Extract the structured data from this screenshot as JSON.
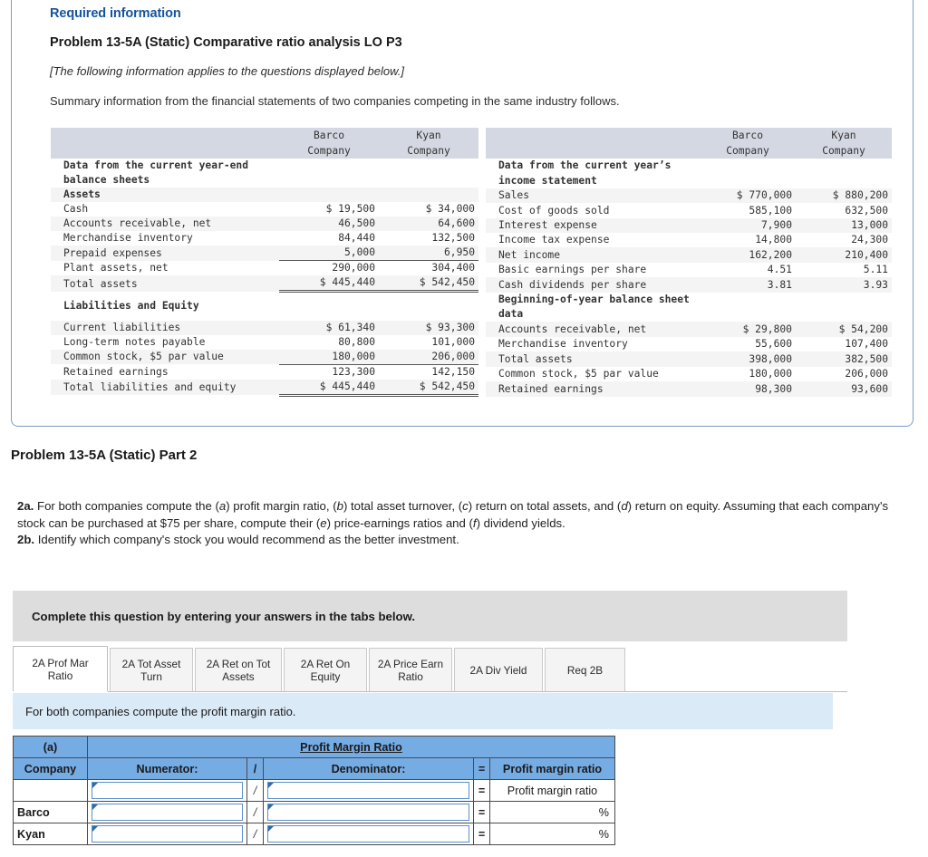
{
  "card": {
    "required_label": "Required information",
    "problem_title": "Problem 13-5A (Static) Comparative ratio analysis LO P3",
    "applies_note": "[The following information applies to the questions displayed below.]",
    "summary": "Summary information from the financial statements of two companies competing in the same industry follows."
  },
  "financials": {
    "col_barco_1": "Barco",
    "col_barco_2": "Company",
    "col_kyan_1": "Kyan",
    "col_kyan_2": "Company",
    "left": {
      "section_title_1": "Data from the current year-end",
      "section_title_2": "balance sheets",
      "assets_header": "Assets",
      "rows": [
        {
          "label": "Cash",
          "barco": "$ 19,500",
          "kyan": "$ 34,000"
        },
        {
          "label": "Accounts receivable, net",
          "barco": "46,500",
          "kyan": "64,600"
        },
        {
          "label": "Merchandise inventory",
          "barco": "84,440",
          "kyan": "132,500"
        },
        {
          "label": "Prepaid expenses",
          "barco": "5,000",
          "kyan": "6,950"
        },
        {
          "label": "Plant assets, net",
          "barco": "290,000",
          "kyan": "304,400"
        }
      ],
      "total_assets": {
        "label": "Total assets",
        "barco": "$ 445,440",
        "kyan": "$ 542,450"
      },
      "liab_header": "Liabilities and Equity",
      "liab_rows": [
        {
          "label": "Current liabilities",
          "barco": "$ 61,340",
          "kyan": "$ 93,300"
        },
        {
          "label": "Long-term notes payable",
          "barco": "80,800",
          "kyan": "101,000"
        },
        {
          "label": "Common stock, $5 par value",
          "barco": "180,000",
          "kyan": "206,000"
        },
        {
          "label": "Retained earnings",
          "barco": "123,300",
          "kyan": "142,150"
        }
      ],
      "total_liab": {
        "label": "Total liabilities and equity",
        "barco": "$ 445,440",
        "kyan": "$ 542,450"
      }
    },
    "right": {
      "section_title_1": "Data from the current year’s",
      "section_title_2": "income statement",
      "rows": [
        {
          "label": "Sales",
          "barco": "$ 770,000",
          "kyan": "$ 880,200"
        },
        {
          "label": "Cost of goods sold",
          "barco": "585,100",
          "kyan": "632,500"
        },
        {
          "label": "Interest expense",
          "barco": "7,900",
          "kyan": "13,000"
        },
        {
          "label": "Income tax expense",
          "barco": "14,800",
          "kyan": "24,300"
        },
        {
          "label": "Net income",
          "barco": "162,200",
          "kyan": "210,400"
        },
        {
          "label": "Basic earnings per share",
          "barco": "4.51",
          "kyan": "5.11"
        },
        {
          "label": "Cash dividends per share",
          "barco": "3.81",
          "kyan": "3.93"
        }
      ],
      "boy_title_1": "Beginning-of-year balance sheet",
      "boy_title_2": "data",
      "boy_rows": [
        {
          "label": "Accounts receivable, net",
          "barco": "$ 29,800",
          "kyan": "$ 54,200"
        },
        {
          "label": "Merchandise inventory",
          "barco": "55,600",
          "kyan": "107,400"
        },
        {
          "label": "Total assets",
          "barco": "398,000",
          "kyan": "382,500"
        },
        {
          "label": "Common stock, $5 par value",
          "barco": "180,000",
          "kyan": "206,000"
        },
        {
          "label": "Retained earnings",
          "barco": "98,300",
          "kyan": "93,600"
        }
      ]
    }
  },
  "part2": {
    "heading": "Problem 13-5A (Static) Part 2",
    "q2a_label": "2a.",
    "q2a_text_1": " For both companies compute the (",
    "q2a_i1": "a",
    "q2a_text_2": ") profit margin ratio, (",
    "q2a_i2": "b",
    "q2a_text_3": ") total asset turnover, (",
    "q2a_i3": "c",
    "q2a_text_4": ") return on total assets, and (",
    "q2a_i4": "d",
    "q2a_text_5": ") return on equity. Assuming that each company's stock can be purchased at $75 per share, compute their (",
    "q2a_i5": "e",
    "q2a_text_6": ") price-earnings ratios and (",
    "q2a_i6": "f",
    "q2a_text_7": ") dividend yields.",
    "q2b_label": "2b.",
    "q2b_text": " Identify which company's stock you would recommend as the better investment."
  },
  "banner": {
    "text": "Complete this question by entering your answers in the tabs below."
  },
  "tabs": [
    {
      "label": "2A Prof Mar Ratio",
      "active": true
    },
    {
      "label": "2A Tot Asset Turn",
      "active": false
    },
    {
      "label": "2A Ret on Tot Assets",
      "active": false
    },
    {
      "label": "2A Ret On Equity",
      "active": false
    },
    {
      "label": "2A Price Earn Ratio",
      "active": false
    },
    {
      "label": "2A Div Yield",
      "active": false
    },
    {
      "label": "Req 2B",
      "active": false
    }
  ],
  "prompt": {
    "text": "For both companies compute the profit margin ratio."
  },
  "answer_table": {
    "part_label": "(a)",
    "ratio_title": "Profit Margin Ratio",
    "col_company": "Company",
    "col_numerator": "Numerator:",
    "col_slash": "/",
    "col_denominator": "Denominator:",
    "col_equals": "=",
    "col_result": "Profit margin ratio",
    "rows": [
      {
        "company": "",
        "slash": "/",
        "equals": "=",
        "result": "Profit margin ratio",
        "pct": ""
      },
      {
        "company": "Barco",
        "slash": "/",
        "equals": "=",
        "result": "",
        "pct": "%"
      },
      {
        "company": "Kyan",
        "slash": "/",
        "equals": "=",
        "result": "",
        "pct": "%"
      }
    ]
  },
  "colors": {
    "accent_blue": "#16539e",
    "card_border": "#7a9cc6",
    "table_header_gray": "#d4d8e2",
    "banner_gray": "#dddddd",
    "prompt_blue": "#daeaf7",
    "grid_header_blue": "#76ace4",
    "input_border": "#5b8fc9"
  }
}
